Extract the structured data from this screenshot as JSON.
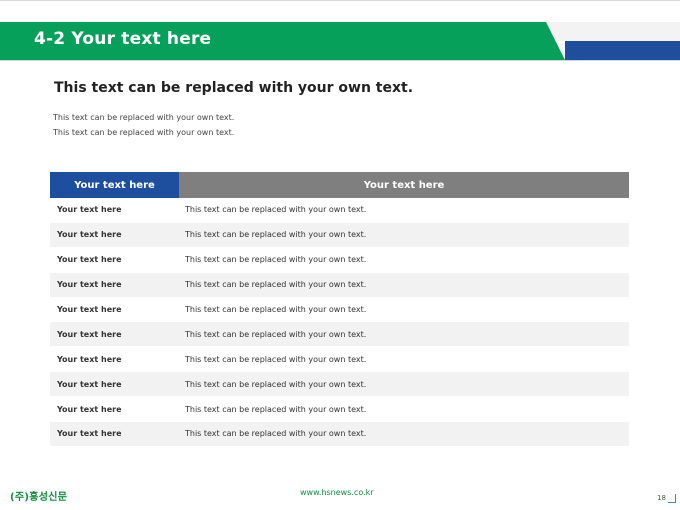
{
  "header": {
    "title": "4-2 Your text here"
  },
  "content": {
    "subtitle": "This text can be replaced with your own text.",
    "lines": [
      "This text can be replaced with your own text.",
      "This text can be replaced with your own text."
    ]
  },
  "table": {
    "headers": [
      "Your text here",
      "Your text here"
    ],
    "rows": [
      {
        "label": "Your text here",
        "text": "This text can be replaced with your own text."
      },
      {
        "label": "Your text here",
        "text": "This text can be replaced with your own text."
      },
      {
        "label": "Your text here",
        "text": "This text can be replaced with your own text."
      },
      {
        "label": "Your text here",
        "text": "This text can be replaced with your own text."
      },
      {
        "label": "Your text here",
        "text": "This text can be replaced with your own text."
      },
      {
        "label": "Your text here",
        "text": "This text can be replaced with your own text."
      },
      {
        "label": "Your text here",
        "text": "This text can be replaced with your own text."
      },
      {
        "label": "Your text here",
        "text": "This text can be replaced with your own text."
      },
      {
        "label": "Your text here",
        "text": "This text can be replaced with your own text."
      },
      {
        "label": "Your text here",
        "text": "This text can be replaced with your own text."
      }
    ]
  },
  "footer": {
    "logo_text": "(주)홍성신문",
    "website": "www.hsnews.co.kr",
    "page_number": "18"
  },
  "colors": {
    "title_green": "#07a05a",
    "accent_blue": "#1f4e9c",
    "header_grey": "#7f7f7f",
    "footer_green": "#118c3c"
  }
}
